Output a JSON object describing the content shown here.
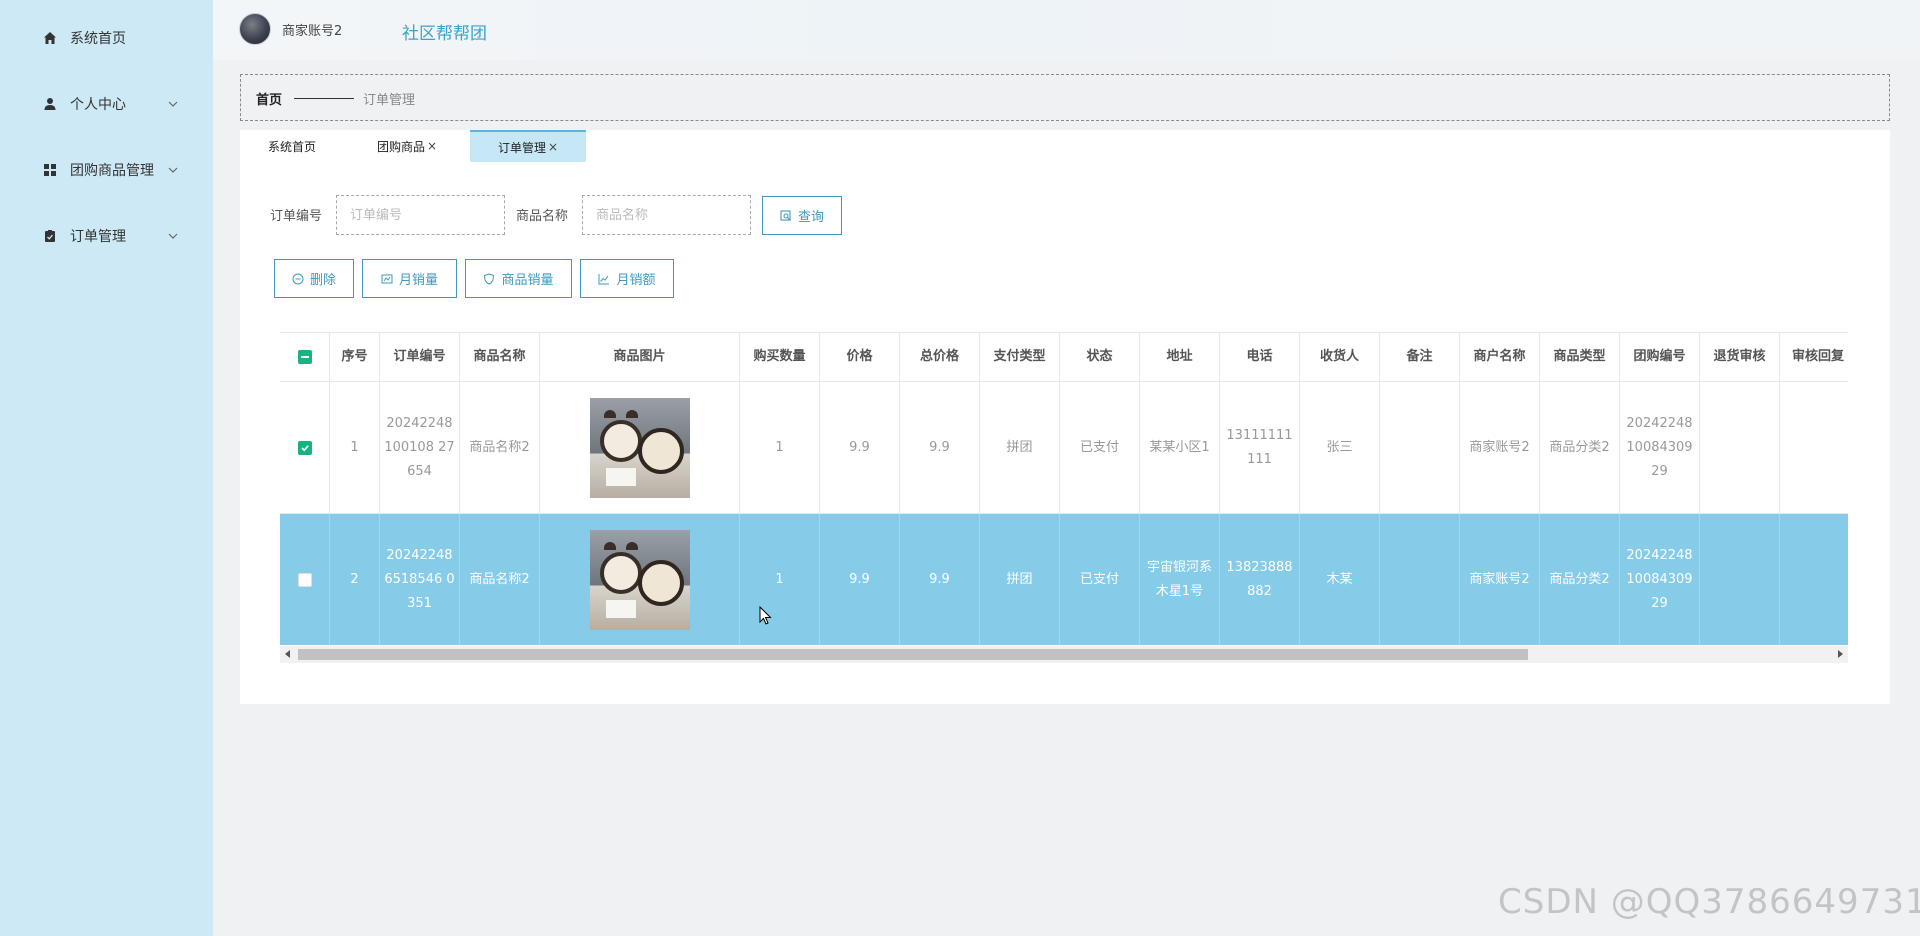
{
  "sidebar": {
    "items": [
      {
        "label": "系统首页",
        "icon": "home-icon"
      },
      {
        "label": "个人中心",
        "icon": "user-icon"
      },
      {
        "label": "团购商品管理",
        "icon": "grid-icon"
      },
      {
        "label": "订单管理",
        "icon": "clipboard-icon"
      }
    ]
  },
  "header": {
    "user_name": "商家账号2",
    "app_title": "社区帮帮团"
  },
  "breadcrumb": {
    "home": "首页",
    "current": "订单管理"
  },
  "tabs": [
    {
      "label": "系统首页",
      "closable": false,
      "active": false
    },
    {
      "label": "团购商品",
      "closable": true,
      "active": false
    },
    {
      "label": "订单管理",
      "closable": true,
      "active": true
    }
  ],
  "search": {
    "order_no_label": "订单编号",
    "order_no_placeholder": "订单编号",
    "product_name_label": "商品名称",
    "product_name_placeholder": "商品名称",
    "query_button": "查询"
  },
  "actions": {
    "delete": "删除",
    "monthly_volume": "月销量",
    "product_volume": "商品销量",
    "monthly_revenue": "月销额"
  },
  "table": {
    "columns": [
      "序号",
      "订单编号",
      "商品名称",
      "商品图片",
      "购买数量",
      "价格",
      "总价格",
      "支付类型",
      "状态",
      "地址",
      "电话",
      "收货人",
      "备注",
      "商户名称",
      "商品类型",
      "团购编号",
      "退货审核",
      "审核回复"
    ],
    "rows": [
      {
        "checked": true,
        "index": "1",
        "order_no": "20242248100108 27654",
        "product_name": "商品名称2",
        "quantity": "1",
        "price": "9.9",
        "total": "9.9",
        "pay_type": "拼团",
        "status": "已支付",
        "address": "某某小区1",
        "phone": "13111111111",
        "receiver": "张三",
        "remark": "",
        "merchant": "商家账号2",
        "category": "商品分类2",
        "group_no": "202422481008430929",
        "return_review": "",
        "review_reply": ""
      },
      {
        "checked": false,
        "index": "2",
        "order_no": "202422486518546 0351",
        "product_name": "商品名称2",
        "quantity": "1",
        "price": "9.9",
        "total": "9.9",
        "pay_type": "拼团",
        "status": "已支付",
        "address": "宇宙银河系木星1号",
        "phone": "13823888882",
        "receiver": "木某",
        "remark": "",
        "merchant": "商家账号2",
        "category": "商品分类2",
        "group_no": "202422481008430929",
        "return_review": "",
        "review_reply": ""
      }
    ]
  },
  "watermark": "CSDN @QQ3786649731",
  "colors": {
    "sidebar_bg": "#cde9f5",
    "accent": "#3f99bf",
    "selected_row": "#86cbe8",
    "checkbox": "#18b47d"
  }
}
